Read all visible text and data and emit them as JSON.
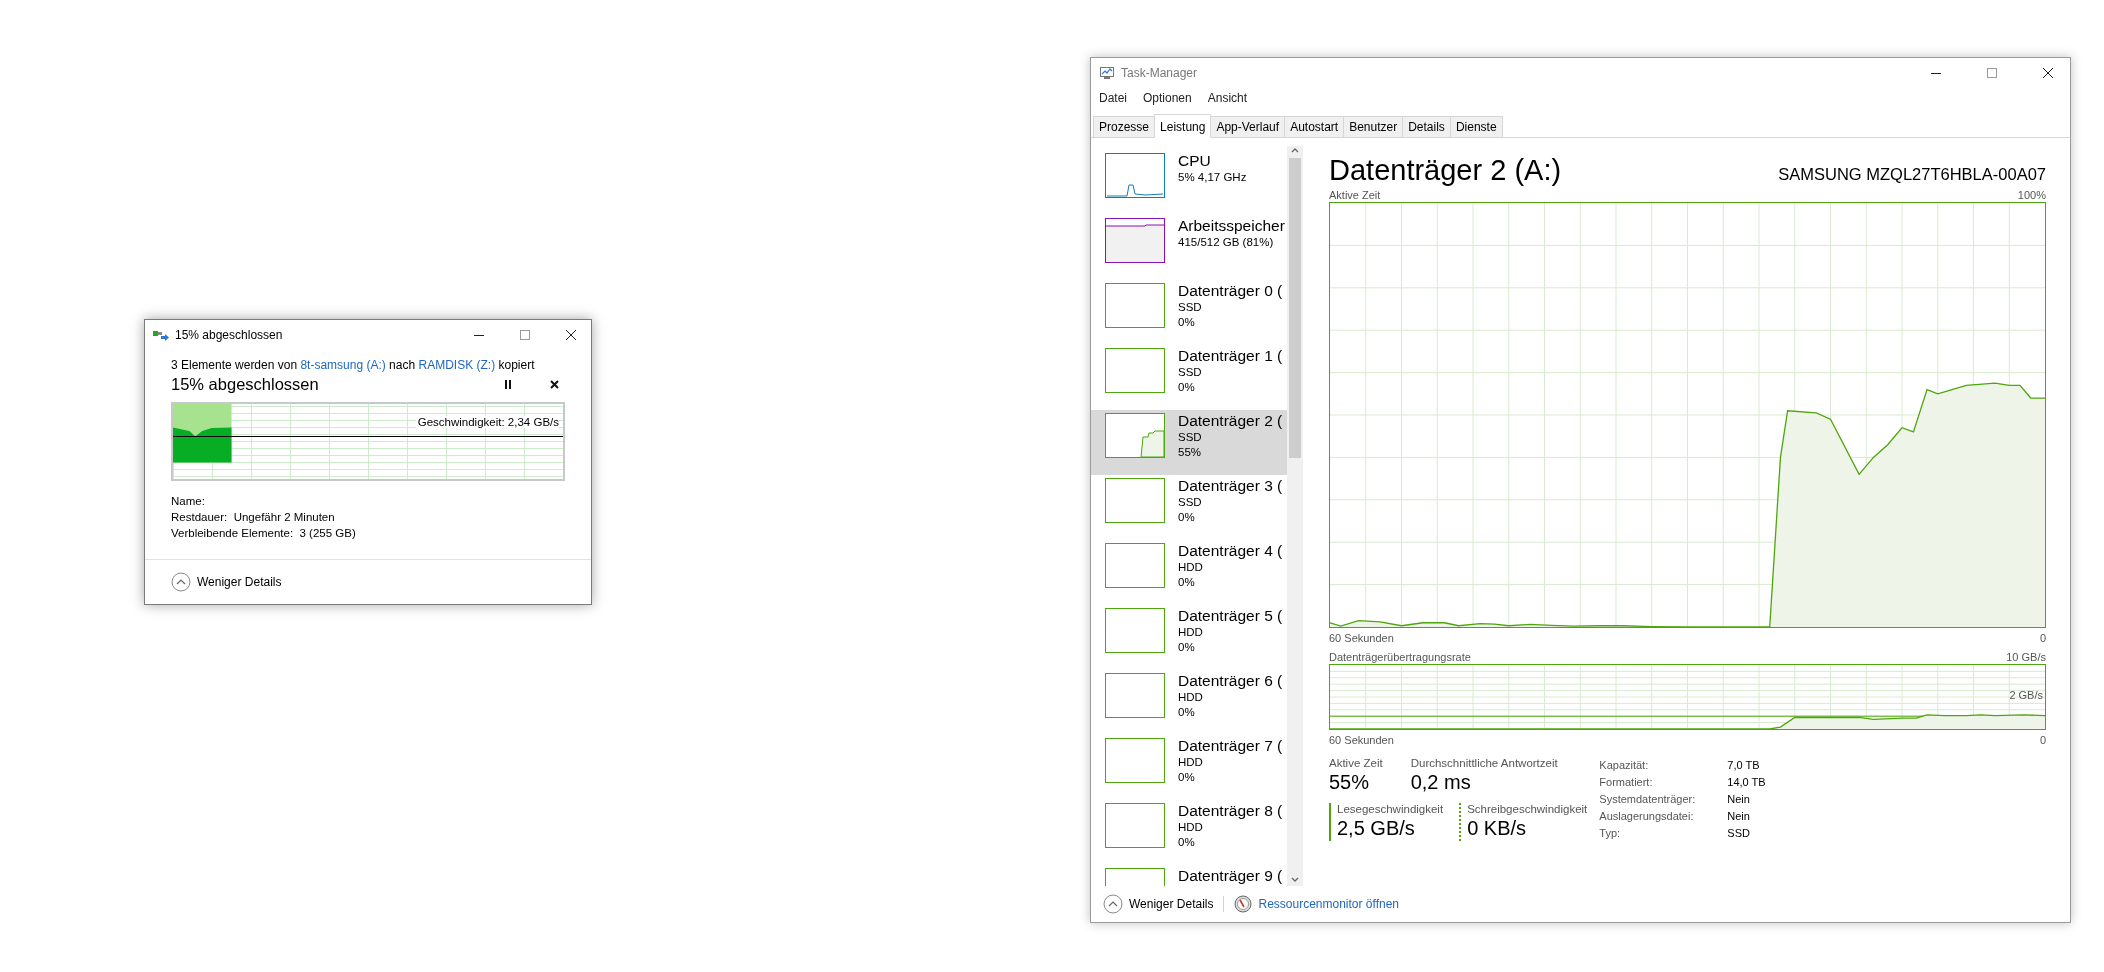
{
  "copy_dialog": {
    "title": "15% abgeschlossen",
    "message": [
      {
        "kind": "text",
        "text": "3 Elemente werden von "
      },
      {
        "kind": "link",
        "text": "8t-samsung (A:)"
      },
      {
        "kind": "text",
        "text": " nach "
      },
      {
        "kind": "link",
        "text": "RAMDISK (Z:)"
      },
      {
        "kind": "text",
        "text": " kopiert"
      }
    ],
    "heading": "15% abgeschlossen",
    "progress": {
      "level": 0.15,
      "speed": "Geschwindigkeit: 2,34 GB/s"
    },
    "details": [
      {
        "label": "Name:"
      },
      {
        "label": "Restdauer:",
        "value": "Ungefähr 2 Minuten"
      },
      {
        "label": "Verbleibende Elemente:",
        "value": "3 (255 GB)"
      }
    ],
    "toggle": "Weniger Details"
  },
  "task_manager": {
    "title": "Task-Manager",
    "menu": [
      "Datei",
      "Optionen",
      "Ansicht"
    ],
    "tabs": [
      {
        "label": "Prozesse",
        "selected": false
      },
      {
        "label": "Leistung",
        "selected": true
      },
      {
        "label": "App-Verlauf",
        "selected": false
      },
      {
        "label": "Autostart",
        "selected": false
      },
      {
        "label": "Benutzer",
        "selected": false
      },
      {
        "label": "Details",
        "selected": false
      },
      {
        "label": "Dienste",
        "selected": false
      }
    ],
    "sidebar": [
      {
        "kind": "cpu",
        "name": "CPU",
        "line_1": "5%  4,17 GHz",
        "selected": false
      },
      {
        "kind": "memory",
        "name": "Arbeitsspeicher",
        "line_1": "415/512 GB (81%)",
        "selected": false
      },
      {
        "kind": "disk",
        "name": "Datenträger 0 (",
        "line_1": "SSD",
        "line_2": "0%",
        "selected": false
      },
      {
        "kind": "disk",
        "name": "Datenträger 1 (",
        "line_1": "SSD",
        "line_2": "0%",
        "selected": false
      },
      {
        "kind": "disk",
        "name": "Datenträger 2 (",
        "line_1": "SSD",
        "line_2": "55%",
        "selected": true
      },
      {
        "kind": "disk",
        "name": "Datenträger 3 (",
        "line_1": "SSD",
        "line_2": "0%",
        "selected": false
      },
      {
        "kind": "disk",
        "name": "Datenträger 4 (",
        "line_1": "HDD",
        "line_2": "0%",
        "selected": false
      },
      {
        "kind": "disk",
        "name": "Datenträger 5 (",
        "line_1": "HDD",
        "line_2": "0%",
        "selected": false
      },
      {
        "kind": "disk",
        "name": "Datenträger 6 (",
        "line_1": "HDD",
        "line_2": "0%",
        "selected": false
      },
      {
        "kind": "disk",
        "name": "Datenträger 7 (",
        "line_1": "HDD",
        "line_2": "0%",
        "selected": false
      },
      {
        "kind": "disk",
        "name": "Datenträger 8 (",
        "line_1": "HDD",
        "line_2": "0%",
        "selected": false
      },
      {
        "kind": "disk",
        "name": "Datenträger 9 (",
        "selected": false
      }
    ],
    "panel": {
      "title": "Datenträger 2 (A:)",
      "model": "SAMSUNG MZQL27T6HBLA-00A07",
      "graph_label": "Aktive Zeit",
      "graph_max": "100%",
      "graph_time": "60 Sekunden",
      "graph_min": "0",
      "rate_label": "Datenträgerübertragungsrate",
      "rate_max": "10 GB/s",
      "rate_mark": "2 GB/s",
      "rate_time": "60 Sekunden",
      "rate_min": "0",
      "stats": [
        {
          "label": "Aktive Zeit",
          "value": "55%"
        },
        {
          "label": "Durchschnittliche Antwortzeit",
          "value": "0,2 ms"
        }
      ],
      "speeds": [
        {
          "kind": "read",
          "label": "Lesegeschwindigkeit",
          "value": "2,5 GB/s"
        },
        {
          "kind": "write",
          "label": "Schreibgeschwindigkeit",
          "value": "0 KB/s"
        }
      ],
      "properties": [
        {
          "label": "Kapazität:",
          "value": "7,0 TB"
        },
        {
          "label": "Formatiert:",
          "value": "14,0 TB"
        },
        {
          "label": "Systemdatenträger:",
          "value": "Nein"
        },
        {
          "label": "Auslagerungsdatei:",
          "value": "Nein"
        },
        {
          "label": "Typ:",
          "value": "SSD"
        }
      ]
    },
    "footer": {
      "toggle": "Weniger Details",
      "link": "Ressourcenmonitor öffnen"
    }
  }
}
